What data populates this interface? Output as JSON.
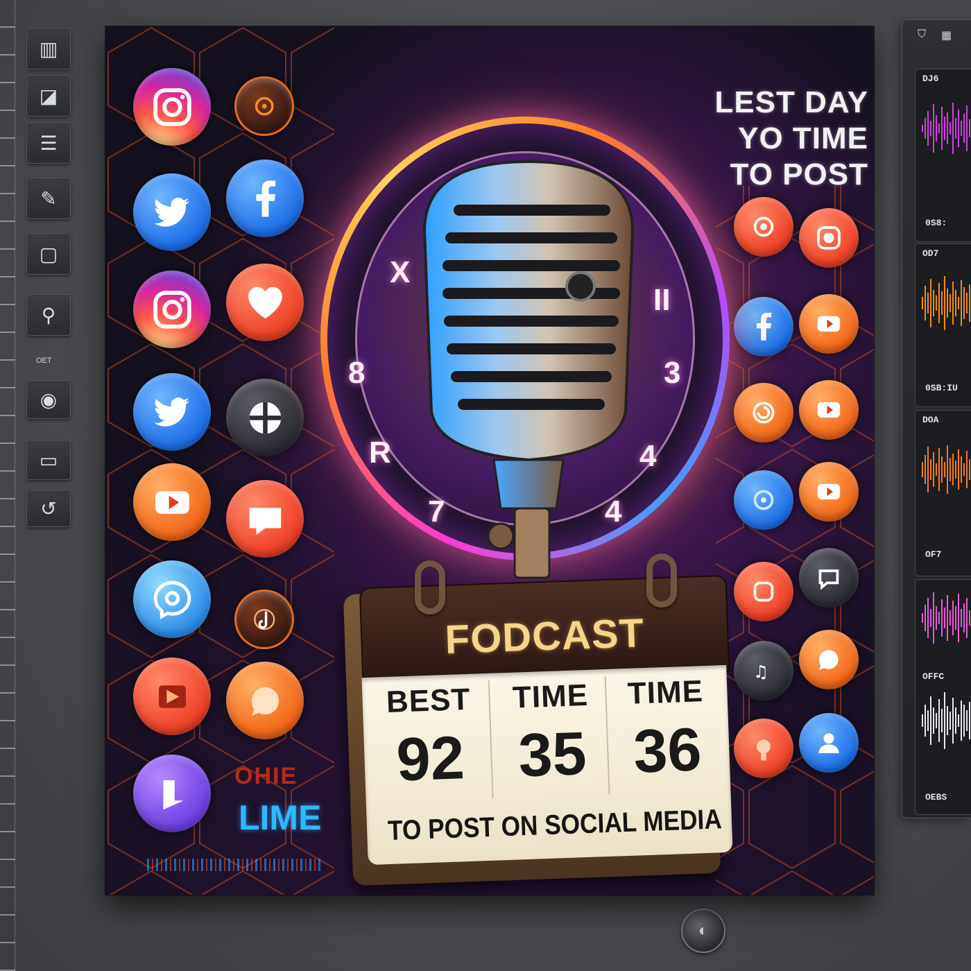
{
  "poster": {
    "headline": [
      "LEST DAY",
      "YO TIME",
      "TO POST"
    ],
    "calendar": {
      "title": "FODCAST",
      "columns": [
        {
          "head": "BEST",
          "num": "92"
        },
        {
          "head": "TIME",
          "num": "35"
        },
        {
          "head": "TIME",
          "num": "36"
        }
      ],
      "footer": "TO POST ON SOCIAL MEDIA"
    },
    "clock_numbers": [
      "X",
      "II",
      "8",
      "3",
      "R",
      "4",
      "7",
      "4"
    ],
    "side_text": {
      "top": "OHIE",
      "main": "LIME"
    }
  },
  "toolbar": {
    "small_label": "OET"
  },
  "panel": {
    "tracks": [
      {
        "label": "DJ6",
        "time": "0S8:"
      },
      {
        "label": "OD7",
        "time": "0SB:IU"
      },
      {
        "label": "DOA",
        "time": "OF7"
      },
      {
        "label": "OFFC",
        "time": "OEBS"
      }
    ]
  },
  "icons": {
    "left_column": [
      "instagram-icon",
      "twitter-icon",
      "instagram-icon",
      "twitter-icon",
      "youtube-icon",
      "messenger-icon",
      "video-icon",
      "bookmark-icon"
    ],
    "mid_column": [
      "podcast-icon",
      "facebook-icon",
      "heart-icon",
      "compass-icon",
      "chat-icon",
      "tiktok-icon",
      "chat-bubble-icon"
    ],
    "right_column": [
      "camera-icon",
      "facebook-icon",
      "youtube-icon",
      "youtube-icon",
      "youtube-icon",
      "bubble-icon",
      "user-icon"
    ],
    "right_inner_column": [
      "threads-icon",
      "facebook-icon",
      "threads-icon",
      "share-icon",
      "whatsapp-icon",
      "music-icon",
      "podcast-icon"
    ]
  },
  "colors": {
    "accent_pink": "#ff3bd4",
    "accent_orange": "#ff7a2a",
    "calendar_title": "#f4d58a",
    "poster_bg": "#15111f"
  }
}
